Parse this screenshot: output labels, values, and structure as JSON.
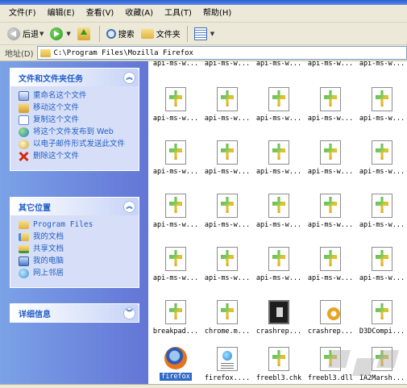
{
  "menubar": {
    "items": [
      "文件(F)",
      "编辑(E)",
      "查看(V)",
      "收藏(A)",
      "工具(T)",
      "帮助(H)"
    ]
  },
  "toolbar": {
    "back_label": "后退",
    "search_label": "搜索",
    "folders_label": "文件夹"
  },
  "address": {
    "label": "地址(D)",
    "value": "C:\\Program Files\\Mozilla Firefox"
  },
  "tasks_panel": {
    "title": "文件和文件夹任务",
    "items": [
      "重命名这个文件",
      "移动这个文件",
      "复制这个文件",
      "将这个文件发布到 Web",
      "以电子邮件形式发送此文件",
      "删除这个文件"
    ]
  },
  "places_panel": {
    "title": "其它位置",
    "items": [
      "Program Files",
      "我的文档",
      "共享文档",
      "我的电脑",
      "网上邻居"
    ]
  },
  "details_panel": {
    "title": "详细信息"
  },
  "files": {
    "rows": [
      [
        "api-ms-w...",
        "api-ms-w...",
        "api-ms-w...",
        "api-ms-w...",
        "api-ms-w..."
      ],
      [
        "api-ms-w...",
        "api-ms-w...",
        "api-ms-w...",
        "api-ms-w...",
        "api-ms-w..."
      ],
      [
        "api-ms-w...",
        "api-ms-w...",
        "api-ms-w...",
        "api-ms-w...",
        "api-ms-w..."
      ],
      [
        "api-ms-w...",
        "api-ms-w...",
        "api-ms-w...",
        "api-ms-w...",
        "api-ms-w..."
      ],
      [
        "api-ms-w...",
        "api-ms-w...",
        "api-ms-w...",
        "api-ms-w...",
        "api-ms-w..."
      ],
      [
        "breakpad...",
        "chrome.m...",
        "crashrep...",
        "crashrep...",
        "D3DCompi..."
      ],
      [
        "firefox",
        "firefox....",
        "freebl3.chk",
        "freebl3.dll",
        "IA2Marsh..."
      ]
    ],
    "icons": [
      [
        "none",
        "none",
        "none",
        "none",
        "none"
      ],
      [
        "dll",
        "dll",
        "dll",
        "dll",
        "dll"
      ],
      [
        "dll",
        "dll",
        "dll",
        "dll",
        "dll"
      ],
      [
        "dll",
        "dll",
        "dll",
        "dll",
        "dll"
      ],
      [
        "dll",
        "dll",
        "dll",
        "dll",
        "dll"
      ],
      [
        "dll",
        "dll",
        "exe-dark",
        "exe-gear",
        "dll"
      ],
      [
        "firefox-ic",
        "doc-web",
        "dll",
        "dll",
        "dll"
      ]
    ],
    "selected": "firefox"
  },
  "colors": {
    "task_link": "#215dc6",
    "taskpane_bg": "#6c8ee0",
    "selection": "#316ac5"
  }
}
